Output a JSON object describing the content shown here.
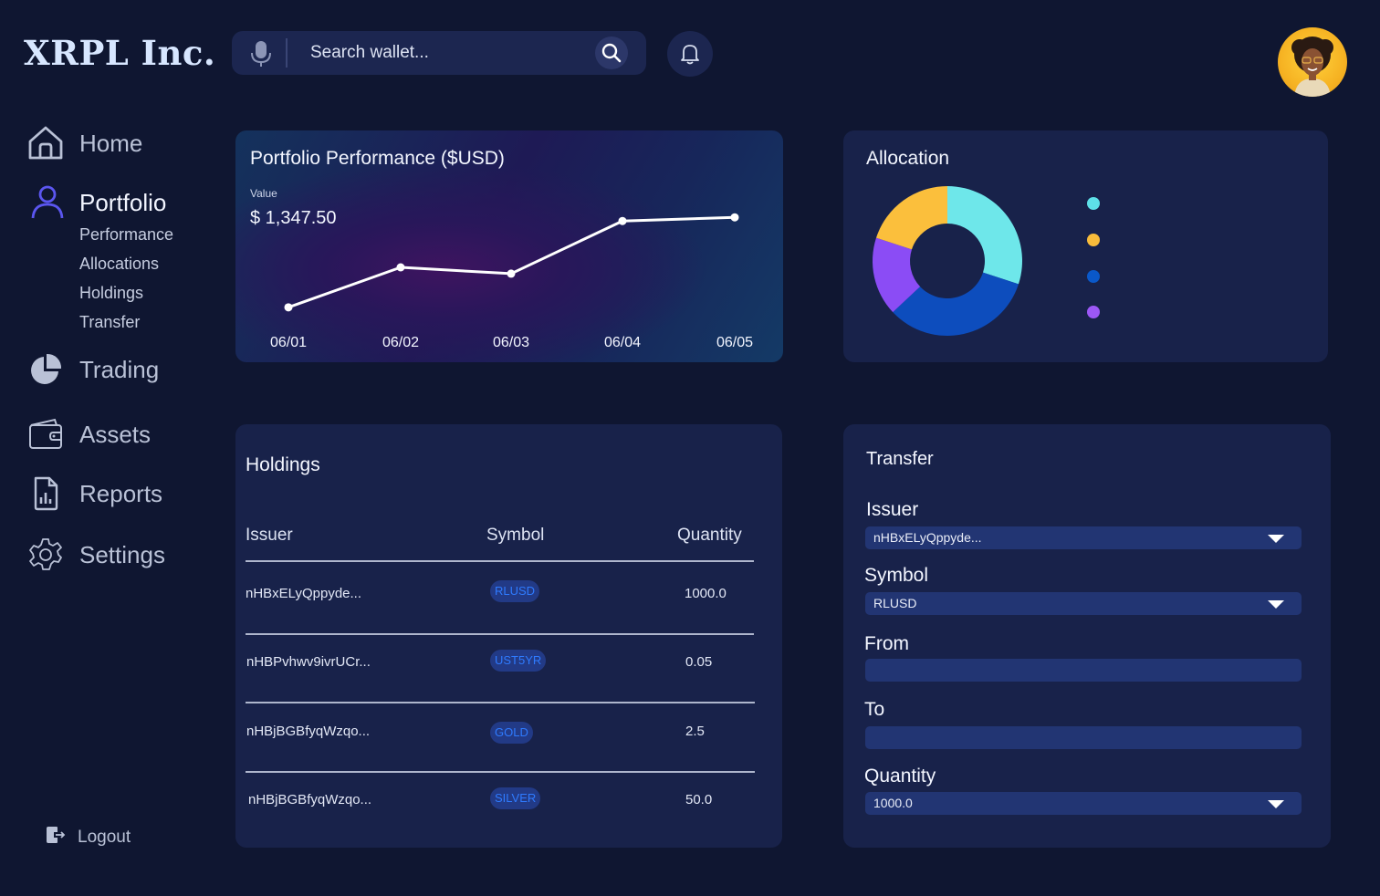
{
  "brand": "XRPL Inc.",
  "search": {
    "placeholder": "Search wallet..."
  },
  "sidebar": {
    "items": [
      {
        "label": "Home"
      },
      {
        "label": "Portfolio"
      },
      {
        "label": "Trading"
      },
      {
        "label": "Assets"
      },
      {
        "label": "Reports"
      },
      {
        "label": "Settings"
      }
    ],
    "sub_items": [
      "Performance",
      "Allocations",
      "Holdings",
      "Transfer"
    ],
    "logout": "Logout"
  },
  "performance": {
    "title": "Portfolio Performance ($USD)",
    "value_label": "Value",
    "value": "$ 1,347.50"
  },
  "chart_data": {
    "type": "line",
    "title": "Portfolio Performance ($USD)",
    "x": [
      "06/01",
      "06/02",
      "06/03",
      "06/04",
      "06/05"
    ],
    "series": [
      {
        "values": [
          920,
          1110,
          1080,
          1330,
          1347.5
        ]
      }
    ],
    "ylim": [
      850,
      1500
    ],
    "grid": false,
    "line_color": "#ffffff"
  },
  "allocation": {
    "title": "Allocation",
    "chart_data": {
      "type": "pie",
      "donut": true,
      "values": [
        30,
        33,
        17,
        20
      ],
      "colors": [
        "#6ee7ea",
        "#0d4dbd",
        "#8b4cf5",
        "#fbbf3c"
      ],
      "legend_colors": [
        "#5ee0e8",
        "#f8bc3b",
        "#0a58c9",
        "#9c58f6"
      ],
      "legend_labels": [
        "",
        "",
        "",
        ""
      ]
    }
  },
  "holdings": {
    "title": "Holdings",
    "columns": [
      "Issuer",
      "Symbol",
      "Quantity"
    ],
    "rows": [
      {
        "issuer": "nHBxELyQppyde...",
        "symbol": "RLUSD",
        "quantity": "1000.0"
      },
      {
        "issuer": "nHBPvhwv9ivrUCr...",
        "symbol": "UST5YR",
        "quantity": "0.05"
      },
      {
        "issuer": "nHBjBGBfyqWzqo...",
        "symbol": "GOLD",
        "quantity": "2.5"
      },
      {
        "issuer": "nHBjBGBfyqWzqo...",
        "symbol": "SILVER",
        "quantity": "50.0"
      }
    ]
  },
  "transfer": {
    "title": "Transfer",
    "issuer_label": "Issuer",
    "issuer_value": "nHBxELyQppyde...",
    "symbol_label": "Symbol",
    "symbol_value": "RLUSD",
    "from_label": "From",
    "from_value": "",
    "to_label": "To",
    "to_value": "",
    "quantity_label": "Quantity",
    "quantity_value": "1000.0"
  },
  "colors": {
    "background": "#0f1631",
    "card": "#18224a",
    "accent": "#5b56f0",
    "field": "#223573",
    "pill_text": "#2f7bff"
  }
}
